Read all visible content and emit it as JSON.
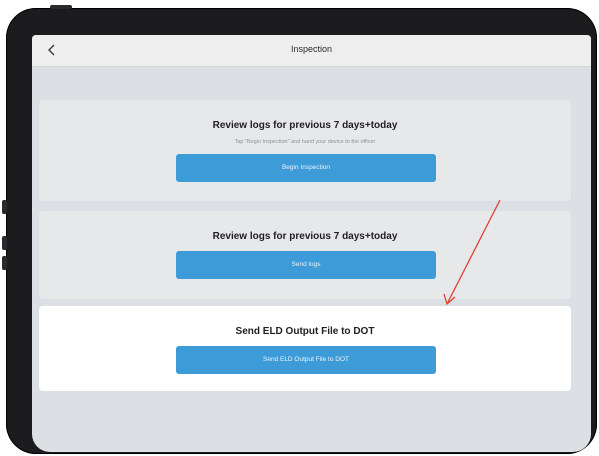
{
  "navbar": {
    "title": "Inspection",
    "back_icon": "chevron-left-icon"
  },
  "cards": [
    {
      "title": "Review logs for previous 7 days+today",
      "subtitle": "Tap \"Begin Inspection\" and hand your device to the officer",
      "button_label": "Begin Inspection"
    },
    {
      "title": "Review logs for previous 7 days+today",
      "button_label": "Send logs"
    },
    {
      "title": "Send ELD Output File to DOT",
      "button_label": "Send ELD Output File to DOT"
    }
  ],
  "annotation": {
    "arrow_color": "#e0412f"
  },
  "colors": {
    "accent": "#3d9bd8",
    "background": "#dcdfe3",
    "card": "#e7e8ea",
    "highlight_card": "#ffffff"
  }
}
